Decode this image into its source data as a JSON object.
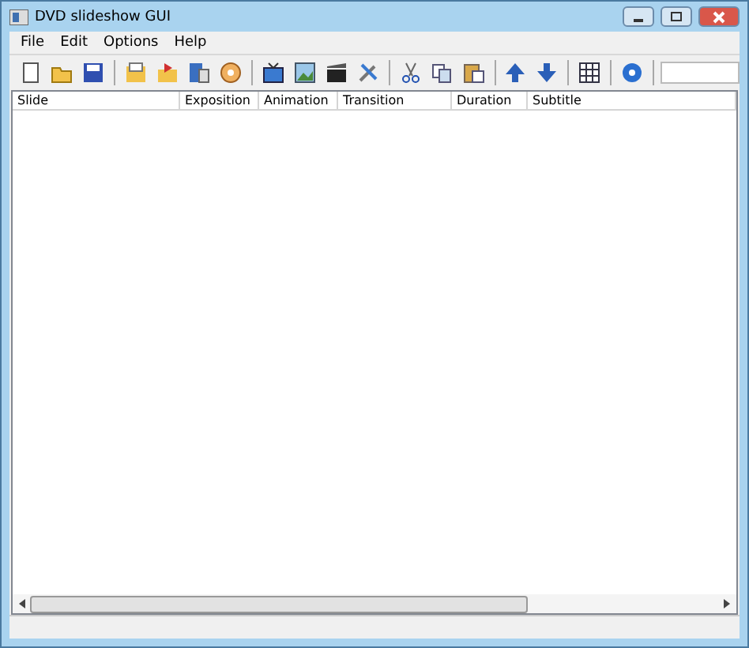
{
  "window": {
    "title": "DVD slideshow GUI"
  },
  "menu": [
    "File",
    "Edit",
    "Options",
    "Help"
  ],
  "toolbar": [
    {
      "kind": "new"
    },
    {
      "kind": "open"
    },
    {
      "kind": "save"
    },
    {
      "kind": "sep"
    },
    {
      "kind": "folder"
    },
    {
      "kind": "export"
    },
    {
      "kind": "disk"
    },
    {
      "kind": "disc"
    },
    {
      "kind": "sep"
    },
    {
      "kind": "tv"
    },
    {
      "kind": "image"
    },
    {
      "kind": "clapper"
    },
    {
      "kind": "tools"
    },
    {
      "kind": "sep"
    },
    {
      "kind": "cut"
    },
    {
      "kind": "copy"
    },
    {
      "kind": "paste"
    },
    {
      "kind": "sep"
    },
    {
      "kind": "up"
    },
    {
      "kind": "down"
    },
    {
      "kind": "sep"
    },
    {
      "kind": "grid"
    },
    {
      "kind": "sep"
    },
    {
      "kind": "help"
    },
    {
      "kind": "sep"
    },
    {
      "kind": "field"
    }
  ],
  "table": {
    "columns": [
      {
        "label": "Slide"
      },
      {
        "label": "Exposition"
      },
      {
        "label": "Animation"
      },
      {
        "label": "Transition"
      },
      {
        "label": "Duration"
      },
      {
        "label": "Subtitle"
      }
    ]
  }
}
